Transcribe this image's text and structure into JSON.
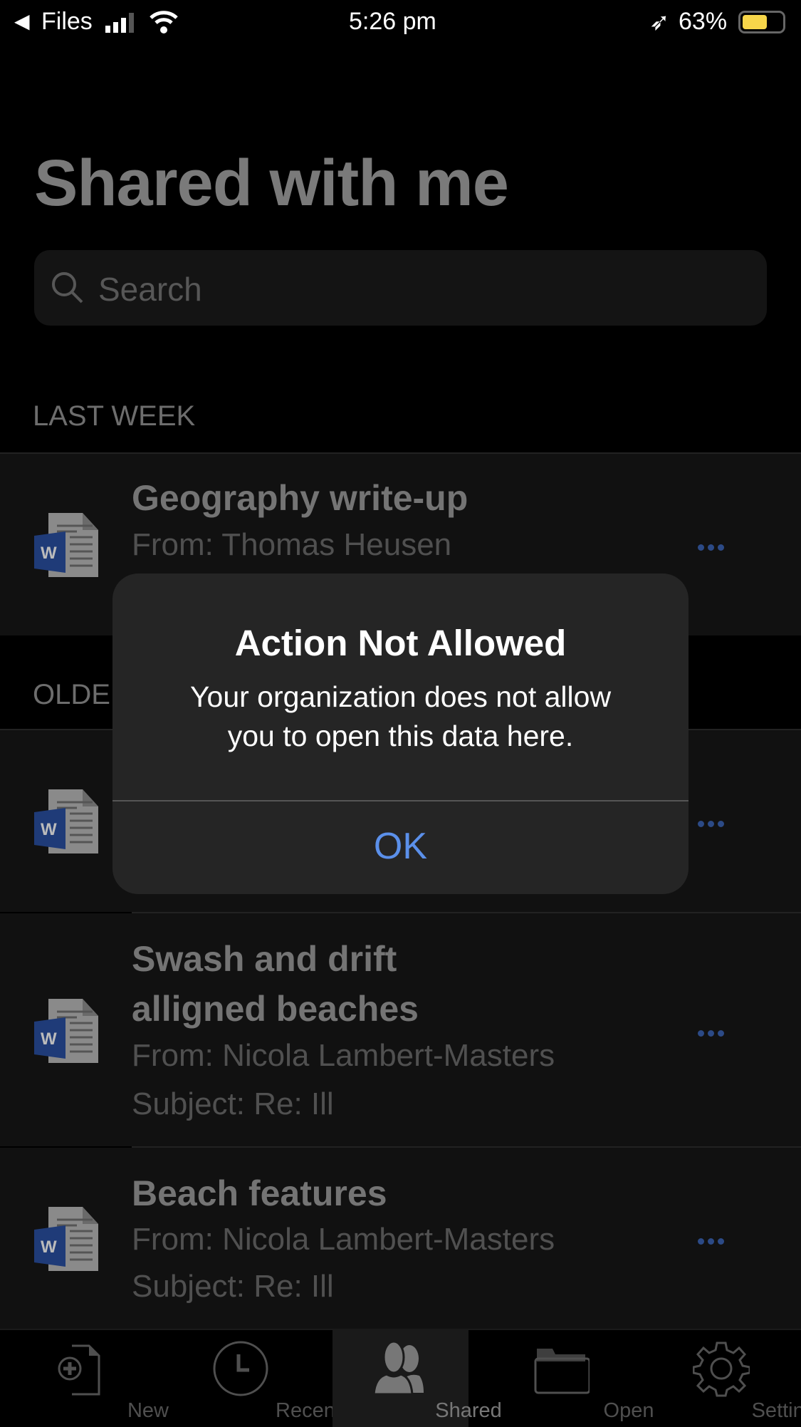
{
  "status_bar": {
    "back_label": "Files",
    "time": "5:26 pm",
    "battery": "63%",
    "battery_level": 0.63,
    "battery_color": "#f7d64a"
  },
  "header": {
    "title": "Shared with me"
  },
  "search": {
    "placeholder": "Search"
  },
  "sections": [
    {
      "label": "LAST WEEK",
      "items": [
        {
          "title": "Geography write-up",
          "from": "From: Thomas Heusen"
        }
      ]
    },
    {
      "label": "OLDER",
      "items": [
        {
          "title": "",
          "from": ""
        },
        {
          "title_line1": "Swash and drift",
          "title_line2": "alligned beaches",
          "from": "From: Nicola Lambert-Masters",
          "subject": "Subject: Re: Ill"
        },
        {
          "title": "Beach features",
          "from": "From: Nicola Lambert-Masters",
          "subject": "Subject: Re: Ill"
        }
      ]
    }
  ],
  "alert": {
    "title": "Action Not Allowed",
    "message_line1": "Your organization does not allow",
    "message_line2": "you to open this data here.",
    "ok": "OK",
    "ok_color": "#5b90ea"
  },
  "tabs": [
    {
      "label": "New",
      "icon": "new-document-icon"
    },
    {
      "label": "Recent",
      "icon": "clock-icon"
    },
    {
      "label": "Shared",
      "icon": "people-icon",
      "selected": true
    },
    {
      "label": "Open",
      "icon": "folder-icon"
    },
    {
      "label": "Settings",
      "icon": "gear-icon"
    }
  ]
}
